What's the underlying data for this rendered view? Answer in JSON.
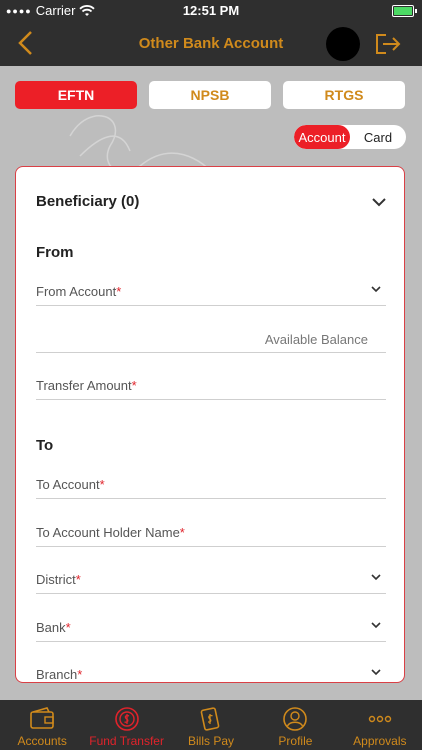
{
  "status_bar": {
    "carrier": "Carrier",
    "time": "12:51 PM"
  },
  "header": {
    "title": "Other Bank Account"
  },
  "transfer_types": [
    {
      "label": "EFTN",
      "active": true
    },
    {
      "label": "NPSB",
      "active": false
    },
    {
      "label": "RTGS",
      "active": false
    }
  ],
  "mode_toggle": {
    "account": "Account",
    "card": "Card",
    "selected": "Account"
  },
  "form": {
    "beneficiary": "Beneficiary (0)",
    "from_heading": "From",
    "from_account": "From Account",
    "available_balance": "Available Balance",
    "transfer_amount": "Transfer Amount",
    "to_heading": "To",
    "to_account": "To Account",
    "to_account_holder": "To Account Holder Name",
    "district": "District",
    "bank": "Bank",
    "branch": "Branch",
    "required_mark": "*"
  },
  "tabbar": [
    {
      "label": "Accounts",
      "icon": "wallet-icon"
    },
    {
      "label": "Fund Transfer",
      "icon": "fund-transfer-icon",
      "active": true
    },
    {
      "label": "Bills Pay",
      "icon": "bills-pay-icon"
    },
    {
      "label": "Profile",
      "icon": "profile-icon"
    },
    {
      "label": "Approvals",
      "icon": "more-icon"
    }
  ],
  "colors": {
    "accent": "#d08a1c",
    "red": "#ec1f27",
    "dark": "#2f2f2f"
  }
}
